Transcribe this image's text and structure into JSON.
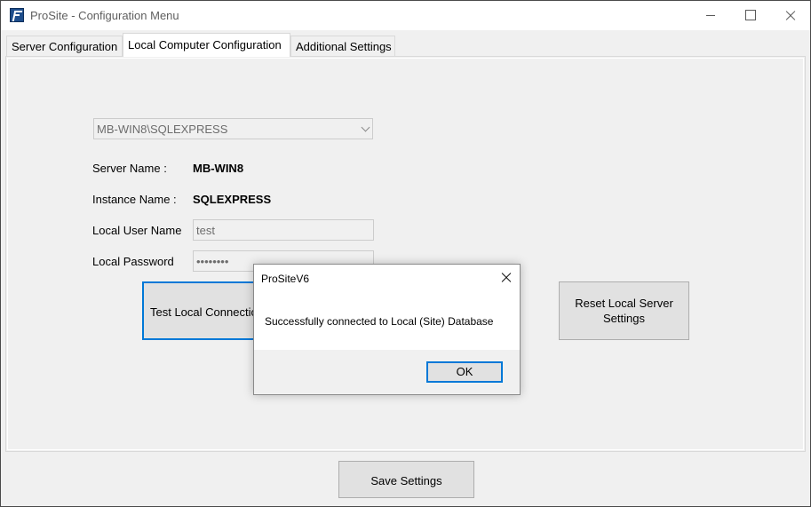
{
  "window": {
    "title": "ProSite - Configuration Menu",
    "app_icon": "prosite-logo-icon"
  },
  "tabs": [
    {
      "label": "Server Configuration",
      "active": false
    },
    {
      "label": "Local Computer Configuration",
      "active": true
    },
    {
      "label": "Additional Settings",
      "active": false
    }
  ],
  "local": {
    "server_select_value": "MB-WIN8\\SQLEXPRESS",
    "server_name_label": "Server Name :",
    "server_name_value": "MB-WIN8",
    "instance_name_label": "Instance Name :",
    "instance_name_value": "SQLEXPRESS",
    "user_name_label": "Local User Name",
    "user_name_value": "test",
    "password_label": "Local Password",
    "password_value": "••••••••",
    "test_button": "Test Local Connection",
    "reset_button": "Reset Local Server Settings"
  },
  "footer": {
    "save_button": "Save Settings"
  },
  "dialog": {
    "title": "ProSiteV6",
    "message": "Successfully connected to Local (Site) Database",
    "ok_button": "OK"
  },
  "colors": {
    "accent": "#0078d7",
    "button_face": "#e1e1e1",
    "window_bg": "#f0f0f0"
  }
}
